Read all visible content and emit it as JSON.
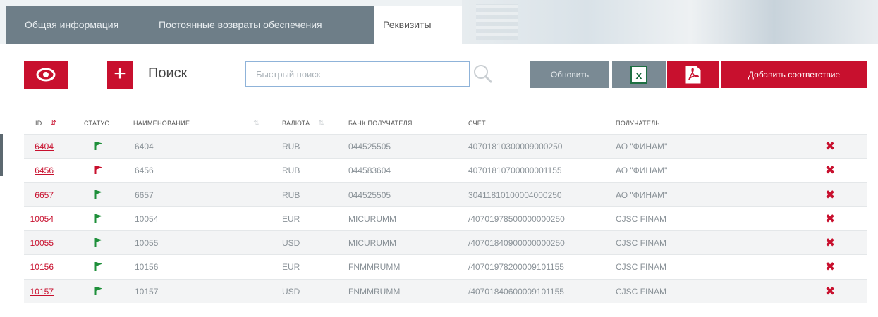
{
  "tabs": {
    "general": "Общая информация",
    "returns": "Постоянные возвраты обеспечения",
    "requisites": "Реквизиты"
  },
  "toolbar": {
    "search_label": "Поиск",
    "search_placeholder": "Быстрый поиск",
    "refresh_label": "Обновить",
    "add_label": "Добавить соответствие",
    "plus_label": "+"
  },
  "colors": {
    "accent_red": "#c8102e",
    "slate": "#7a8a94",
    "flag_green": "#1e8f3a"
  },
  "table": {
    "headers": {
      "id": "ID",
      "status": "СТАТУС",
      "name": "НАИМЕНОВАНИЕ",
      "currency": "ВАЛЮТА",
      "bank": "БАНК ПОЛУЧАТЕЛЯ",
      "account": "СЧЕТ",
      "recipient": "ПОЛУЧАТЕЛЬ"
    },
    "rows": [
      {
        "id": "6404",
        "status": "green",
        "name": "6404",
        "currency": "RUB",
        "bank": "044525505",
        "account": "40701810300009000250",
        "recipient": "АО \"ФИНАМ\""
      },
      {
        "id": "6456",
        "status": "red",
        "name": "6456",
        "currency": "RUB",
        "bank": "044583604",
        "account": "40701810700000001155",
        "recipient": "АО \"ФИНАМ\""
      },
      {
        "id": "6657",
        "status": "green",
        "name": "6657",
        "currency": "RUB",
        "bank": "044525505",
        "account": "30411810100004000250",
        "recipient": "АО \"ФИНАМ\""
      },
      {
        "id": "10054",
        "status": "green",
        "name": "10054",
        "currency": "EUR",
        "bank": "MICURUMM",
        "account": "/40701978500000000250",
        "recipient": "CJSC FINAM"
      },
      {
        "id": "10055",
        "status": "green",
        "name": "10055",
        "currency": "USD",
        "bank": "MICURUMM",
        "account": "/40701840900000000250",
        "recipient": "CJSC FINAM"
      },
      {
        "id": "10156",
        "status": "green",
        "name": "10156",
        "currency": "EUR",
        "bank": "FNMMRUMM",
        "account": "/40701978200009101155",
        "recipient": "CJSC FINAM"
      },
      {
        "id": "10157",
        "status": "green",
        "name": "10157",
        "currency": "USD",
        "bank": "FNMMRUMM",
        "account": "/40701840600009101155",
        "recipient": "CJSC FINAM"
      }
    ]
  }
}
